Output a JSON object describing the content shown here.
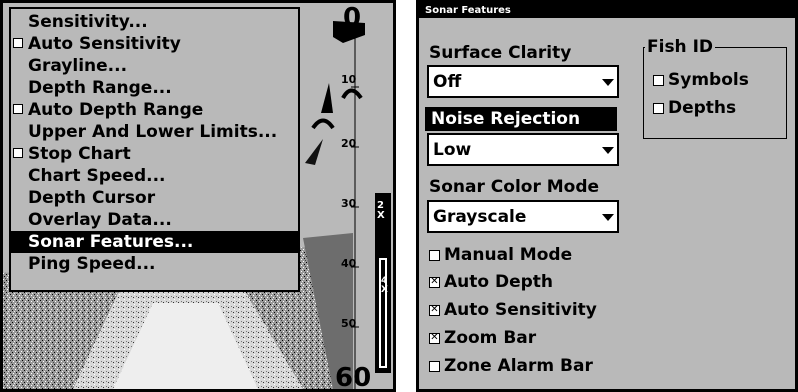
{
  "left_screen": {
    "depth_scale": [
      "0",
      "10",
      "20",
      "30",
      "40",
      "50",
      "60"
    ],
    "zoom_labels": [
      "2X",
      "4X"
    ],
    "menu": {
      "items": [
        {
          "label": "Sensitivity...",
          "checkbox": false,
          "selected": false
        },
        {
          "label": "Auto Sensitivity",
          "checkbox": true,
          "selected": false
        },
        {
          "label": "Grayline...",
          "checkbox": false,
          "selected": false
        },
        {
          "label": "Depth Range...",
          "checkbox": false,
          "selected": false
        },
        {
          "label": "Auto Depth Range",
          "checkbox": true,
          "selected": false
        },
        {
          "label": "Upper And Lower Limits...",
          "checkbox": false,
          "selected": false
        },
        {
          "label": "Stop Chart",
          "checkbox": true,
          "selected": false
        },
        {
          "label": "Chart Speed...",
          "checkbox": false,
          "selected": false
        },
        {
          "label": "Depth Cursor",
          "checkbox": false,
          "selected": false
        },
        {
          "label": "Overlay Data...",
          "checkbox": false,
          "selected": false
        },
        {
          "label": "Sonar Features...",
          "checkbox": false,
          "selected": true
        },
        {
          "label": "Ping Speed...",
          "checkbox": false,
          "selected": false
        }
      ]
    }
  },
  "right_screen": {
    "title": "Sonar Features",
    "surface_clarity": {
      "label": "Surface Clarity",
      "value": "Off"
    },
    "noise_rejection": {
      "label": "Noise Rejection",
      "value": "Low"
    },
    "sonar_color_mode": {
      "label": "Sonar Color Mode",
      "value": "Grayscale"
    },
    "checkboxes": [
      {
        "label": "Manual Mode",
        "checked": false
      },
      {
        "label": "Auto Depth",
        "checked": true
      },
      {
        "label": "Auto Sensitivity",
        "checked": true
      },
      {
        "label": "Zoom Bar",
        "checked": true
      },
      {
        "label": "Zone Alarm Bar",
        "checked": false
      }
    ],
    "fish_id": {
      "title": "Fish ID",
      "options": [
        {
          "label": "Symbols",
          "checked": false
        },
        {
          "label": "Depths",
          "checked": false
        }
      ]
    }
  }
}
